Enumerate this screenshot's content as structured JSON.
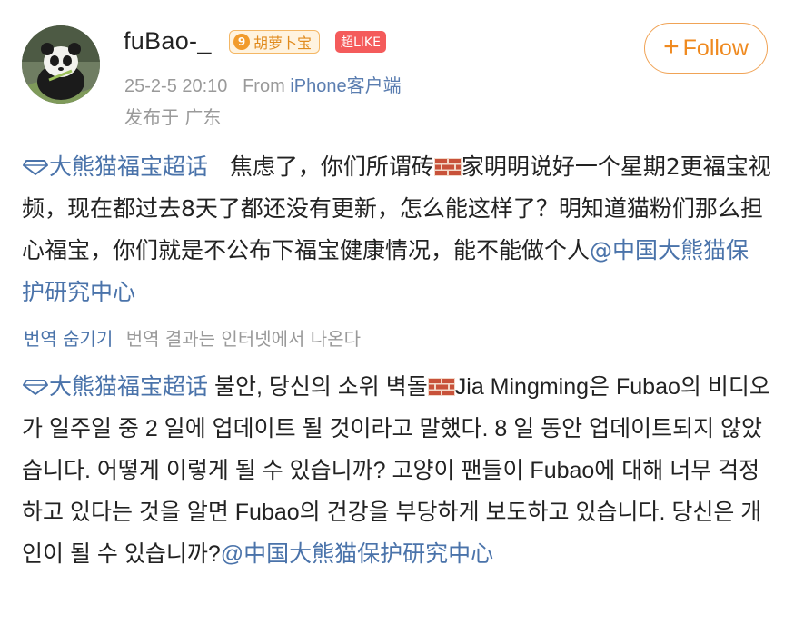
{
  "user": {
    "name": "fuBao-_",
    "badge_level": "9",
    "badge_name": "胡萝卜宝",
    "like_badge": "超LIKE"
  },
  "meta": {
    "time": "25-2-5 20:10",
    "from_label": "From",
    "source": "iPhone客户端",
    "location": "发布于 广东"
  },
  "follow_label": "Follow",
  "post": {
    "topic": "大熊猫福宝超话",
    "text_before_brick": "焦虑了，你们所谓砖",
    "text_after_brick": "家明明说好一个星期2更福宝视频，现在都过去8天了都还没有更新，怎么能这样了？明知道猫粉们那么担心福宝，你们就是不公布下福宝健康情况，能不能做个人",
    "mention": "@中国大熊猫保护研究中心"
  },
  "translation_bar": {
    "hide_label": "번역 숨기기",
    "note": "번역 결과는 인터넷에서 나온다"
  },
  "translation": {
    "topic": "大熊猫福宝超话",
    "text_before_brick": "불안, 당신의 소위 벽돌",
    "text_after_brick": "Jia Mingming은 Fubao의 비디오가 일주일 중 2 일에 업데이트 될 것이라고 말했다. 8 일 동안 업데이트되지 않았습니다. 어떻게 이렇게 될 수 있습니까? 고양이 팬들이 Fubao에 대해 너무 걱정하고 있다는 것을 알면 Fubao의 건강을 부당하게 보도하고 있습니다. 당신은 개인이 될 수 있습니까?",
    "mention": "@中国大熊猫保护研究中心"
  },
  "colors": {
    "link": "#4a73aa",
    "follow": "#ef8a20",
    "meta": "#9a9a9a"
  }
}
